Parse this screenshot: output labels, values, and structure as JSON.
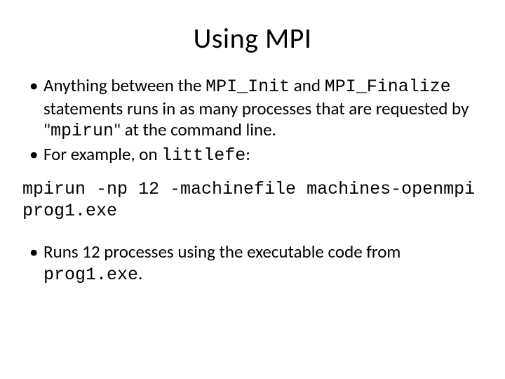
{
  "title": "Using MPI",
  "bullets1": {
    "b1": {
      "t1": "Anything between the ",
      "c1": "MPI_Init",
      "t2": " and ",
      "c2": "MPI_Finalize",
      "t3": " statements runs in as many processes that are requested by \"",
      "c3": "mpirun",
      "t4": "\" at the command line."
    },
    "b2": {
      "t1": "For example, on ",
      "c1": "littlefe",
      "t2": ":"
    }
  },
  "command": "mpirun -np 12 -machinefile machines-openmpi prog1.exe",
  "bullets2": {
    "b1": {
      "t1": "Runs 12 processes using the executable code from ",
      "c1": "prog1.exe",
      "t2": "."
    }
  }
}
